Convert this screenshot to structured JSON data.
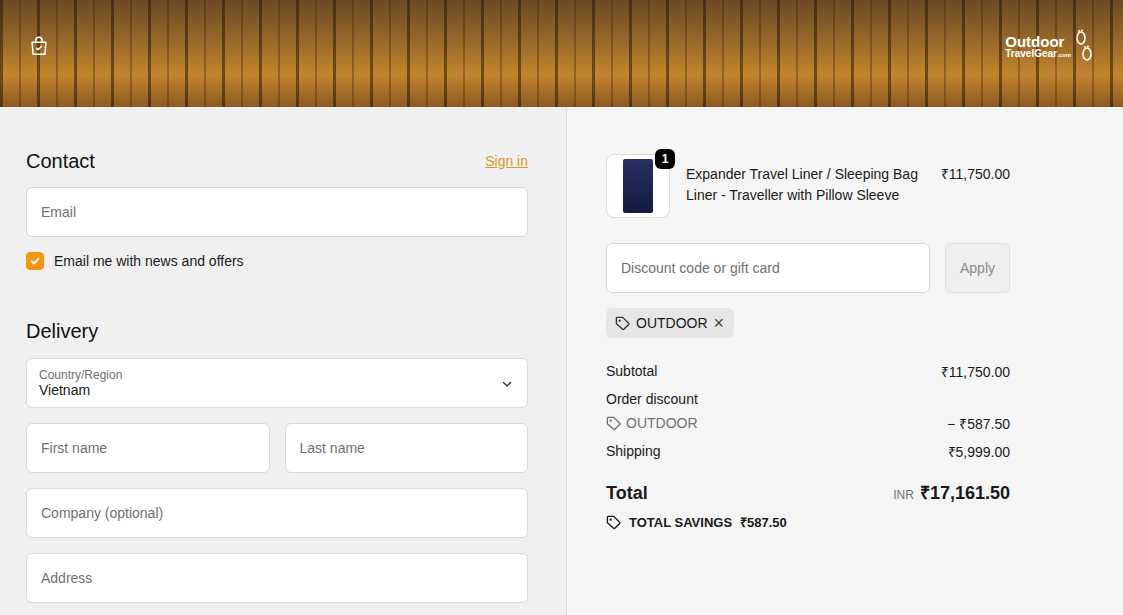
{
  "header": {
    "logo": {
      "line1": "Outdoor",
      "line2": "TravelGear",
      "suffix": ".com"
    }
  },
  "contact": {
    "title": "Contact",
    "sign_in": "Sign in",
    "email_placeholder": "Email",
    "newsletter": {
      "label": "Email me with news and offers",
      "checked": true
    }
  },
  "delivery": {
    "title": "Delivery",
    "country": {
      "label": "Country/Region",
      "value": "Vietnam"
    },
    "rows": [
      [
        "First name",
        "Last name"
      ],
      [
        "Company (optional)"
      ],
      [
        "Address"
      ]
    ]
  },
  "summary": {
    "items": [
      {
        "quantity": "1",
        "title": "Expander Travel Liner / Sleeping Bag Liner - Traveller with Pillow Sleeve",
        "price": "₹11,750.00"
      }
    ],
    "discount": {
      "placeholder": "Discount code or gift card",
      "button": "Apply",
      "applied": [
        {
          "code": "OUTDOOR",
          "remove": "×"
        }
      ]
    },
    "subtotal": {
      "label": "Subtotal",
      "value": "₹11,750.00"
    },
    "order_discount": {
      "label": "Order discount",
      "code": "OUTDOOR",
      "value": "− ₹587.50"
    },
    "shipping": {
      "label": "Shipping",
      "value": "₹5,999.00"
    },
    "total": {
      "label": "Total",
      "currency": "INR",
      "amount": "₹17,161.50"
    },
    "savings": {
      "label": "TOTAL SAVINGS",
      "amount": "₹587.50"
    }
  }
}
